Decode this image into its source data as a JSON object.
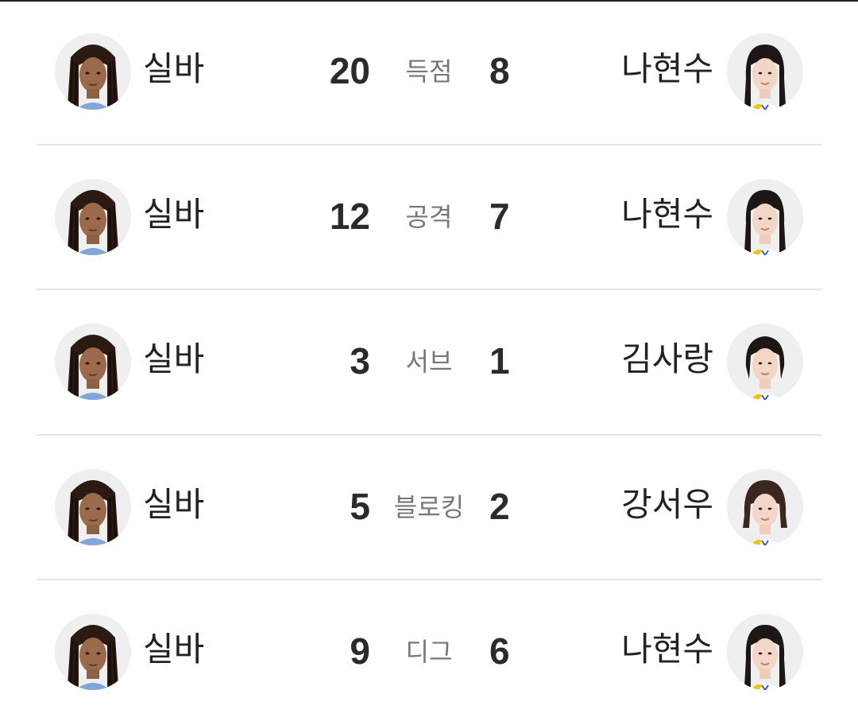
{
  "rows": [
    {
      "category": "득점",
      "left": {
        "player": "실바",
        "value": "20",
        "avatar": "braided-hair-player-photo"
      },
      "right": {
        "player": "나현수",
        "value": "8",
        "avatar": "long-hair-player-photo"
      }
    },
    {
      "category": "공격",
      "left": {
        "player": "실바",
        "value": "12",
        "avatar": "braided-hair-player-photo"
      },
      "right": {
        "player": "나현수",
        "value": "7",
        "avatar": "long-hair-player-photo"
      }
    },
    {
      "category": "서브",
      "left": {
        "player": "실바",
        "value": "3",
        "avatar": "braided-hair-player-photo"
      },
      "right": {
        "player": "김사랑",
        "value": "1",
        "avatar": "short-hair-player-photo"
      }
    },
    {
      "category": "블로킹",
      "left": {
        "player": "실바",
        "value": "5",
        "avatar": "braided-hair-player-photo"
      },
      "right": {
        "player": "강서우",
        "value": "2",
        "avatar": "bangs-player-photo"
      }
    },
    {
      "category": "디그",
      "left": {
        "player": "실바",
        "value": "9",
        "avatar": "braided-hair-player-photo"
      },
      "right": {
        "player": "나현수",
        "value": "6",
        "avatar": "long-hair-player-photo"
      }
    }
  ],
  "colors": {
    "text": "#222222",
    "category": "#777777",
    "divider": "#e4e4e4",
    "jersey_left": "#7fa6d6",
    "jersey_right": "#f2c200"
  }
}
